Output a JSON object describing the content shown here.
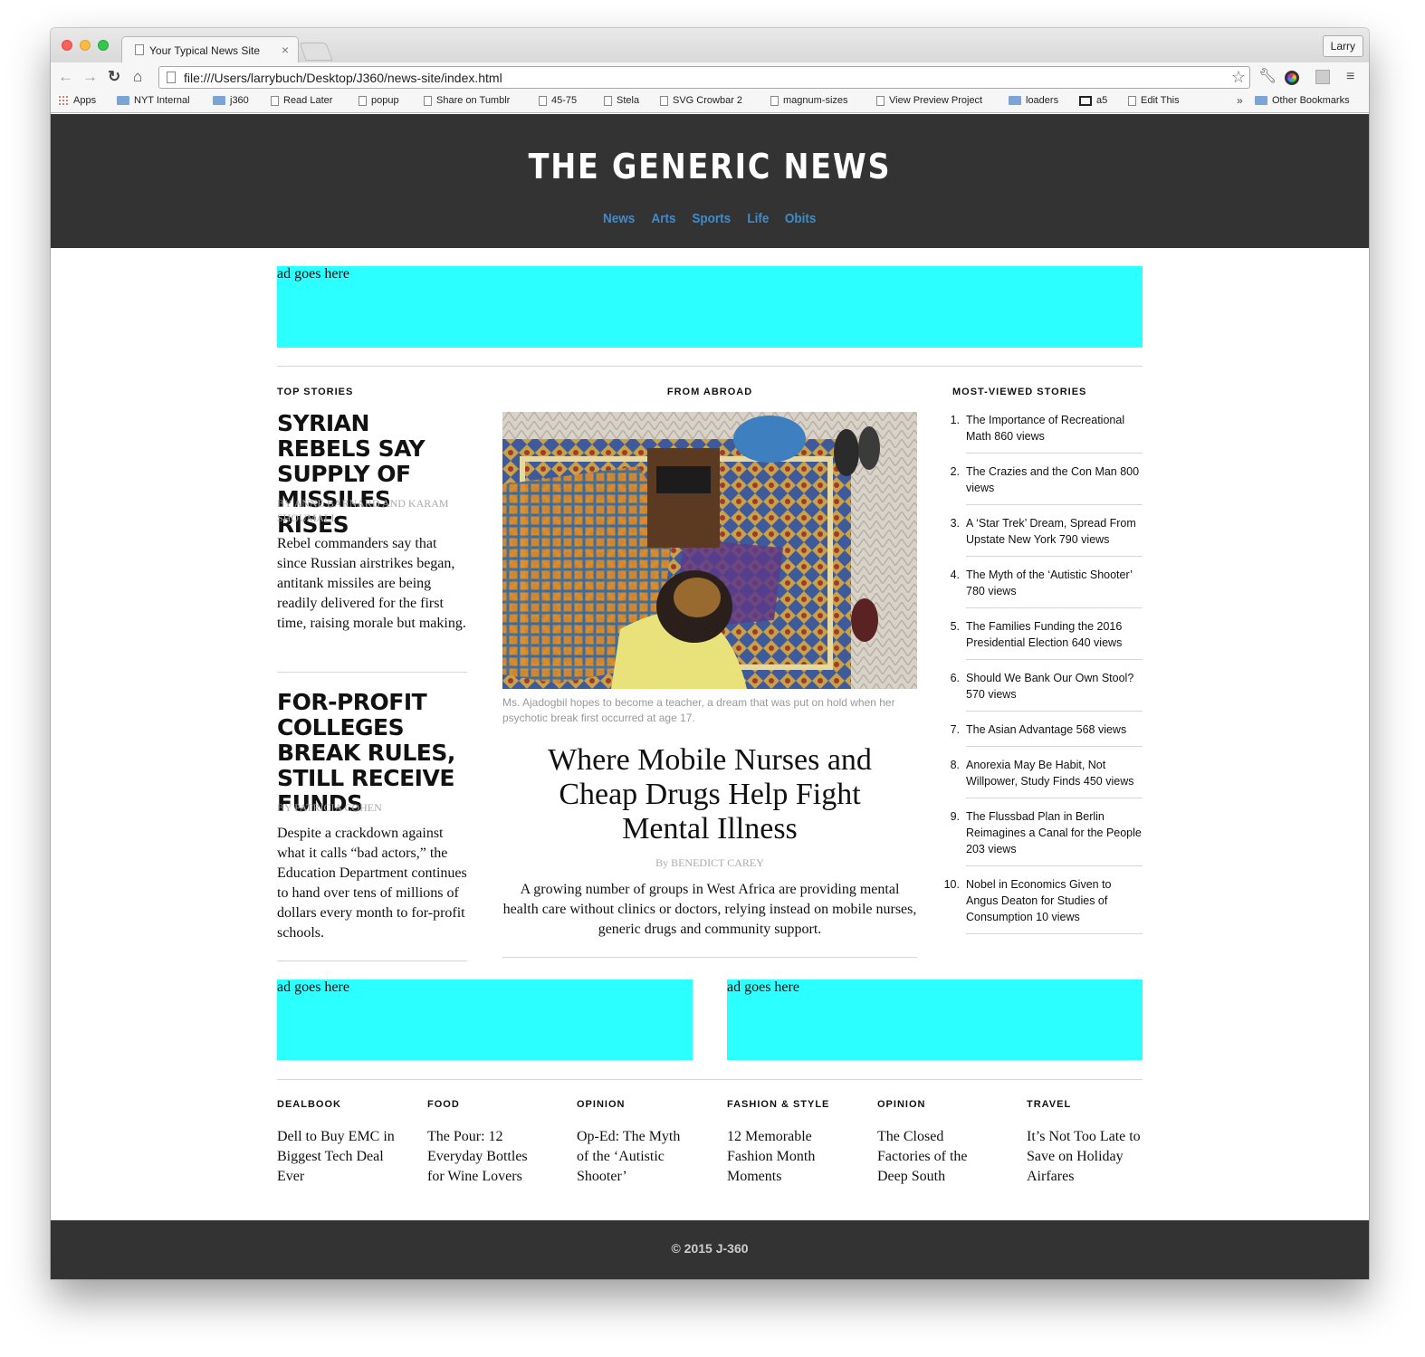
{
  "browser": {
    "tab_title": "Your Typical News Site",
    "profile": "Larry",
    "url": "file:///Users/larrybuch/Desktop/J360/news-site/index.html",
    "bookmarks": [
      "Apps",
      "NYT Internal",
      "j360",
      "Read Later",
      "popup",
      "Share on Tumblr",
      "45-75",
      "Stela",
      "SVG Crowbar 2",
      "magnum-sizes",
      "View Preview Project",
      "loaders",
      "a5",
      "Edit This"
    ],
    "bookmarks_more": "»",
    "other_bookmarks": "Other Bookmarks"
  },
  "site": {
    "title": "THE GENERIC NEWS",
    "nav": [
      "News",
      "Arts",
      "Sports",
      "Life",
      "Obits"
    ],
    "ad_text": "ad goes here",
    "footer": "© 2015 J-360"
  },
  "colors": {
    "header_bg": "#333333",
    "nav_link": "#3f8ccc",
    "ad_bg": "#2bffff"
  },
  "top_stories": {
    "label": "TOP STORIES",
    "stories": [
      {
        "headline": "SYRIAN REBELS SAY SUPPLY OF MISSILES RISES",
        "byline": "By ANNE BARNARD and KARAM SHOUMALI",
        "summary": "Rebel commanders say that since Russian airstrikes began, antitank missiles are being readily delivered for the first time, raising morale but making."
      },
      {
        "headline": "FOR-PROFIT COLLEGES BREAK RULES, STILL RECEIVE FUNDS",
        "byline": "By PATRICIA COHEN",
        "summary": "Despite a crackdown against what it calls “bad actors,” the Education Department continues to hand over tens of millions of dollars every month to for-profit schools."
      }
    ]
  },
  "from_abroad": {
    "label": "FROM ABROAD",
    "caption": "Ms. Ajadogbil hopes to become a teacher, a dream that was put on hold when her psychotic break first occurred at age 17.",
    "headline": "Where Mobile Nurses and Cheap Drugs Help Fight Mental Illness",
    "byline": "By BENEDICT CAREY",
    "summary": "A growing number of groups in West Africa are providing mental health care without clinics or doctors, relying instead on mobile nurses, generic drugs and community support."
  },
  "most_viewed": {
    "label": "MOST-VIEWED STORIES",
    "items": [
      {
        "num": "1.",
        "text": "The Importance of Recreational Math 860 views"
      },
      {
        "num": "2.",
        "text": "The Crazies and the Con Man 800 views"
      },
      {
        "num": "3.",
        "text": "A ‘Star Trek’ Dream, Spread From Upstate New York 790 views"
      },
      {
        "num": "4.",
        "text": "The Myth of the ‘Autistic Shooter’ 780 views"
      },
      {
        "num": "5.",
        "text": "The Families Funding the 2016 Presidential Election 640 views"
      },
      {
        "num": "6.",
        "text": "Should We Bank Our Own Stool? 570 views"
      },
      {
        "num": "7.",
        "text": "The Asian Advantage 568 views"
      },
      {
        "num": "8.",
        "text": "Anorexia May Be Habit, Not Willpower, Study Finds 450 views"
      },
      {
        "num": "9.",
        "text": "The Flussbad Plan in Berlin Reimagines a Canal for the People 203 views"
      },
      {
        "num": "10.",
        "text": "Nobel in Economics Given to Angus Deaton for Studies of Consumption 10 views"
      }
    ]
  },
  "sections": [
    {
      "label": "DEALBOOK",
      "title": "Dell to Buy EMC in Biggest Tech Deal Ever"
    },
    {
      "label": "FOOD",
      "title": "The Pour: 12 Everyday Bottles for Wine Lovers"
    },
    {
      "label": "OPINION",
      "title": "Op-Ed: The Myth of the ‘Autistic Shooter’"
    },
    {
      "label": "FASHION & STYLE",
      "title": "12 Memorable Fashion Month Moments"
    },
    {
      "label": "OPINION",
      "title": "The Closed Factories of the Deep South"
    },
    {
      "label": "TRAVEL",
      "title": "It’s Not Too Late to Save on Holiday Airfares"
    }
  ]
}
